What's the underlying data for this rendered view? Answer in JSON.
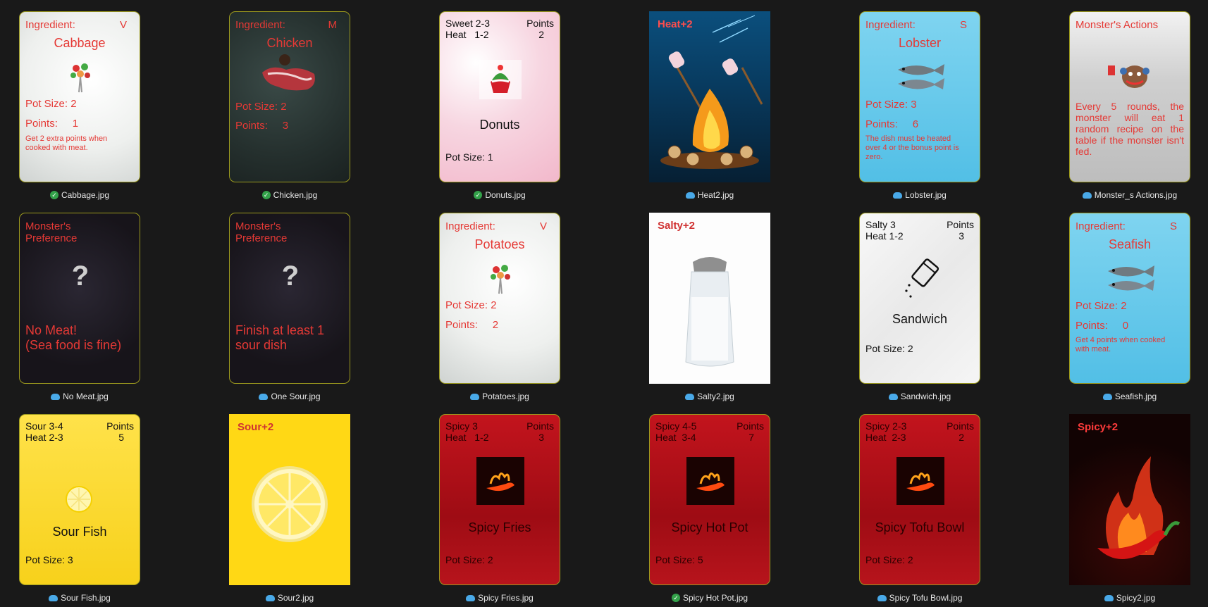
{
  "cards": [
    {
      "file": "Cabbage.jpg",
      "status": "synced",
      "status_icon": "check-circle-icon",
      "header_left": "Ingredient:",
      "header_right": "V",
      "name": "Cabbage",
      "pot_size": "Pot Size: 2",
      "points": "Points:     1",
      "note": "Get 2 extra points when cooked with meat."
    },
    {
      "file": "Chicken.jpg",
      "status": "synced",
      "status_icon": "check-circle-icon",
      "header_left": "Ingredient:",
      "header_right": "M",
      "name": "Chicken",
      "pot_size": "Pot Size: 2",
      "points": "Points:     3"
    },
    {
      "file": "Donuts.jpg",
      "status": "synced",
      "status_icon": "check-circle-icon",
      "stat1": "Sweet 2-3",
      "stat2": "Heat   1-2",
      "points_label": "Points",
      "points_value": "2",
      "name": "Donuts",
      "pot_size": "Pot Size: 1"
    },
    {
      "file": "Heat2.jpg",
      "status": "cloud",
      "status_icon": "cloud-icon",
      "title": "Heat+2"
    },
    {
      "file": "Lobster.jpg",
      "status": "cloud",
      "status_icon": "cloud-icon",
      "header_left": "Ingredient:",
      "header_right": "S",
      "name": "Lobster",
      "pot_size": "Pot Size: 3",
      "points": "Points:     6",
      "note": "The dish must be heated over 4 or the bonus point is zero."
    },
    {
      "file": "Monster_s Actions.jpg",
      "status": "cloud",
      "status_icon": "cloud-icon",
      "title": "Monster's Actions",
      "text": "Every 5 rounds, the monster will eat 1 random recipe on the table if the monster isn't fed."
    },
    {
      "file": "No Meat.jpg",
      "status": "cloud",
      "status_icon": "cloud-icon",
      "title": "Monster's Preference",
      "text": "No Meat!\n(Sea food is fine)"
    },
    {
      "file": "One Sour.jpg",
      "status": "cloud",
      "status_icon": "cloud-icon",
      "title": "Monster's Preference",
      "text": "Finish at least 1 sour dish"
    },
    {
      "file": "Potatoes.jpg",
      "status": "cloud",
      "status_icon": "cloud-icon",
      "header_left": "Ingredient:",
      "header_right": "V",
      "name": "Potatoes",
      "pot_size": "Pot Size: 2",
      "points": "Points:     2"
    },
    {
      "file": "Salty2.jpg",
      "status": "cloud",
      "status_icon": "cloud-icon",
      "title": "Salty+2"
    },
    {
      "file": "Sandwich.jpg",
      "status": "cloud",
      "status_icon": "cloud-icon",
      "stat1": "Salty 3",
      "stat2": "Heat 1-2",
      "points_label": "Points",
      "points_value": "3",
      "name": "Sandwich",
      "pot_size": "Pot Size: 2"
    },
    {
      "file": "Seafish.jpg",
      "status": "cloud",
      "status_icon": "cloud-icon",
      "header_left": "Ingredient:",
      "header_right": "S",
      "name": "Seafish",
      "pot_size": "Pot Size: 2",
      "points": "Points:     0",
      "note": "Get 4 points when cooked with meat."
    },
    {
      "file": "Sour Fish.jpg",
      "status": "cloud",
      "status_icon": "cloud-icon",
      "stat1": "Sour 3-4",
      "stat2": "Heat 2-3",
      "points_label": "Points",
      "points_value": "5",
      "name": "Sour Fish",
      "pot_size": "Pot Size: 3"
    },
    {
      "file": "Sour2.jpg",
      "status": "cloud",
      "status_icon": "cloud-icon",
      "title": "Sour+2"
    },
    {
      "file": "Spicy Fries.jpg",
      "status": "cloud",
      "status_icon": "cloud-icon",
      "stat1": "Spicy 3",
      "stat2": "Heat   1-2",
      "points_label": "Points",
      "points_value": "3",
      "name": "Spicy Fries",
      "pot_size": "Pot Size: 2"
    },
    {
      "file": "Spicy Hot Pot.jpg",
      "status": "synced",
      "status_icon": "check-circle-icon",
      "stat1": "Spicy 4-5",
      "stat2": "Heat  3-4",
      "points_label": "Points",
      "points_value": "7",
      "name": "Spicy Hot Pot",
      "pot_size": "Pot Size: 5"
    },
    {
      "file": "Spicy Tofu Bowl.jpg",
      "status": "cloud",
      "status_icon": "cloud-icon",
      "stat1": "Spicy 2-3",
      "stat2": "Heat  2-3",
      "points_label": "Points",
      "points_value": "2",
      "name": "Spicy Tofu Bowl",
      "pot_size": "Pot Size: 2"
    },
    {
      "file": "Spicy2.jpg",
      "status": "cloud",
      "status_icon": "cloud-icon",
      "title": "Spicy+2"
    }
  ]
}
